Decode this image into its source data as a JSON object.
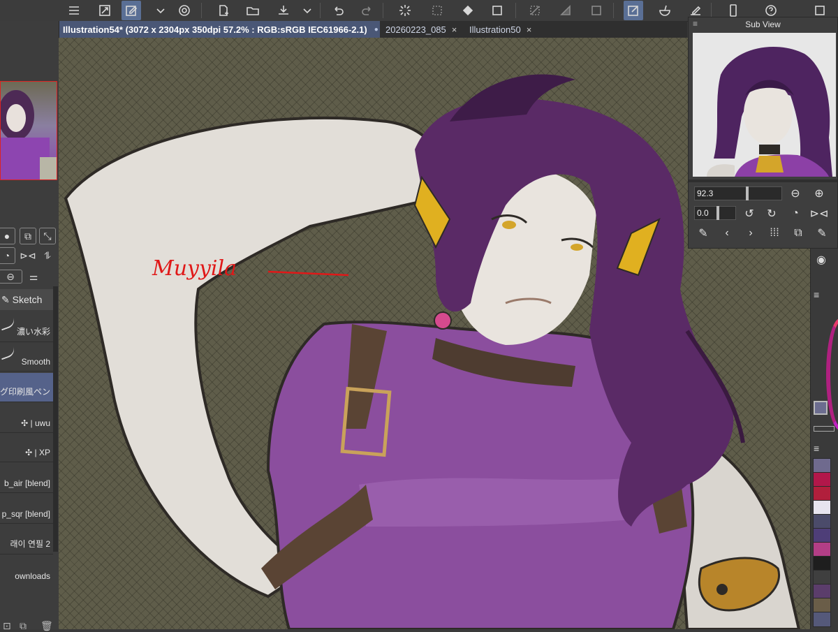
{
  "window": {
    "tabs": [
      {
        "label": "Illustration54* (3072 x 2304px 350dpi 57.2% : RGB:sRGB IEC61966-2.1)",
        "modified_dot": "●",
        "active": true
      },
      {
        "label": "20260223_085",
        "close": "×",
        "active": false
      },
      {
        "label": "Illustration50",
        "close": "×",
        "active": false
      }
    ]
  },
  "toolbar": {
    "icons": [
      "menu-icon",
      "fit-icon",
      "pen-active-icon",
      "chevron-down-icon",
      "spiral-icon",
      "new-file-icon",
      "open-folder-icon",
      "save-icon",
      "chevron-down-icon",
      "undo-icon",
      "redo-icon",
      "loading-icon",
      "clear-icon",
      "fill-icon",
      "transform-icon",
      "deselect-icon",
      "invert-icon",
      "select-all-icon",
      "edit-active-icon",
      "bowl-icon",
      "ruler-pen-icon",
      "device-icon",
      "help-icon"
    ]
  },
  "left_panel": {
    "tool_tab": "Sketch",
    "brushes": [
      {
        "label": "濃い水彩"
      },
      {
        "label": "Smooth"
      },
      {
        "label": "グ印刷風ペン",
        "selected": true
      },
      {
        "label": "✣ | uwu"
      },
      {
        "label": "✣ | XP"
      },
      {
        "label": "b_air [blend]"
      },
      {
        "label": "p_sqr [blend]"
      },
      {
        "label": "래이 연필 2"
      },
      {
        "label": "ownloads"
      }
    ]
  },
  "canvas": {
    "signature": "Muyyila",
    "colors": {
      "background": "#5f5d4a",
      "hair": "#5a2a66",
      "top": "#8a4fa0",
      "skin": "#e6e2dc",
      "accent_gold": "#e0b020",
      "signature_red": "#e01818"
    }
  },
  "sub_view": {
    "title": "Sub View",
    "zoom_value": "92.3",
    "rotation_value": "0.0"
  },
  "palette": {
    "colors": [
      "#6f6a8e",
      "#b2174a",
      "#b11f3c",
      "#e7e4ef",
      "#4b4b6a",
      "#4e3e78",
      "#b23e86",
      "#1e1e1e",
      "#3f3f3f",
      "#5b3d6b",
      "#6a5d48",
      "#55597a"
    ]
  }
}
